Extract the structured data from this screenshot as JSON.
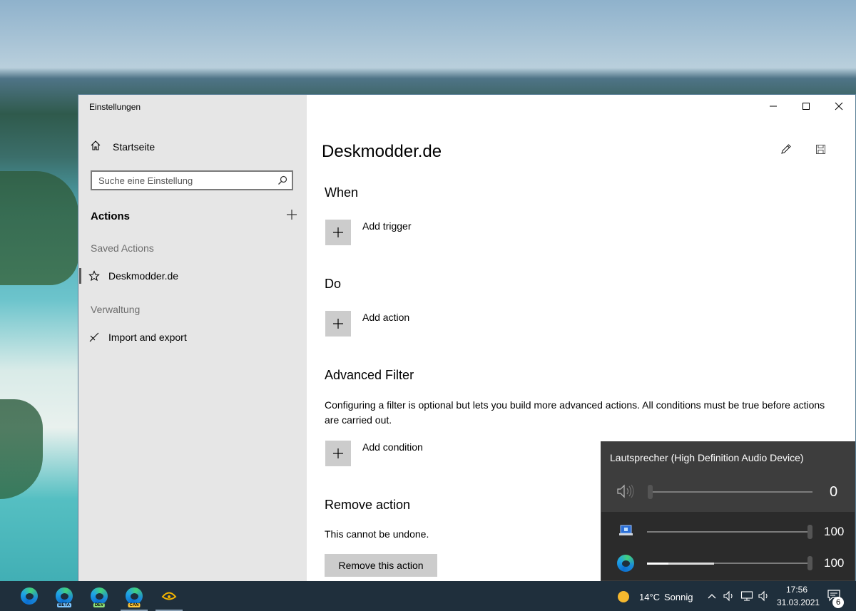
{
  "window": {
    "title": "Einstellungen",
    "controls": {
      "minimize": "minimize",
      "maximize": "maximize",
      "close": "close"
    }
  },
  "sidebar": {
    "home_label": "Startseite",
    "search": {
      "placeholder": "Suche eine Einstellung",
      "value": ""
    },
    "section_title": "Actions",
    "groups": [
      {
        "label": "Saved Actions",
        "items": [
          {
            "label": "Deskmodder.de",
            "icon": "star-icon",
            "selected": true
          }
        ]
      },
      {
        "label": "Verwaltung",
        "items": [
          {
            "label": "Import and export",
            "icon": "import-export-icon",
            "selected": false
          }
        ]
      }
    ]
  },
  "main": {
    "title": "Deskmodder.de",
    "when": {
      "heading": "When",
      "add_label": "Add trigger"
    },
    "do": {
      "heading": "Do",
      "add_label": "Add action"
    },
    "filter": {
      "heading": "Advanced Filter",
      "description": "Configuring a filter is optional but lets you build more advanced actions. All conditions must be true before actions are carried out.",
      "add_label": "Add condition"
    },
    "remove": {
      "heading": "Remove action",
      "warning": "This cannot be undone.",
      "button_label": "Remove this action"
    }
  },
  "volume_flyout": {
    "device": "Lautsprecher (High Definition Audio Device)",
    "master_value": "0",
    "apps": [
      {
        "icon": "system-sounds-icon",
        "value": "100",
        "level": 1.0
      },
      {
        "icon": "edge-icon",
        "value": "100",
        "level": 1.0,
        "peak": 0.41
      }
    ]
  },
  "taskbar": {
    "apps": [
      {
        "name": "edge",
        "badge": ""
      },
      {
        "name": "edge-beta",
        "badge": "BETA"
      },
      {
        "name": "edge-dev",
        "badge": "DEV"
      },
      {
        "name": "edge-canary",
        "badge": "CAN"
      },
      {
        "name": "deskmodder-app",
        "badge": ""
      }
    ],
    "weather": {
      "temp": "14°C",
      "condition": "Sonnig"
    },
    "time": "17:56",
    "date": "31.03.2021",
    "notification_count": "6"
  },
  "colors": {
    "accent": "#0078d7",
    "sidebar_bg": "#e6e6e6",
    "button_bg": "#cccccc",
    "flyout_bg": "#2b2b2b"
  }
}
